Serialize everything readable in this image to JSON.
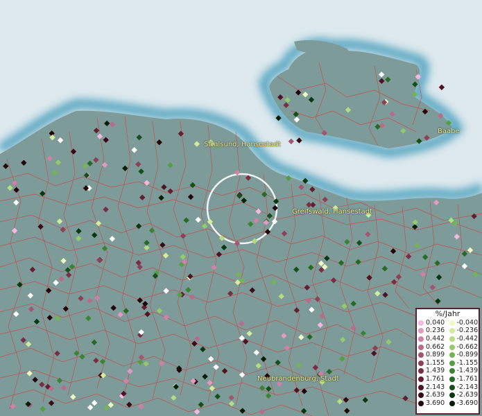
{
  "map": {
    "labels": [
      {
        "text": "Stralsund, Hansestadt"
      },
      {
        "text": "Greifswald, Hansestadt"
      },
      {
        "text": "Neubrandenburg, Stadt"
      },
      {
        "text": "Baabe"
      }
    ]
  },
  "legend": {
    "title": "%/Jahr",
    "positive": [
      {
        "value": "0.040",
        "color": "#f6b8df"
      },
      {
        "value": "0.236",
        "color": "#e39ac1"
      },
      {
        "value": "0.442",
        "color": "#d081a5"
      },
      {
        "value": "0.662",
        "color": "#b86c8a"
      },
      {
        "value": "0.899",
        "color": "#a35671"
      },
      {
        "value": "1.155",
        "color": "#8e4058"
      },
      {
        "value": "1.439",
        "color": "#792e44"
      },
      {
        "value": "1.761",
        "color": "#641e32"
      },
      {
        "value": "2.143",
        "color": "#4e1222"
      },
      {
        "value": "2.639",
        "color": "#380915"
      },
      {
        "value": "3.690",
        "color": "#22030a"
      }
    ],
    "negative": [
      {
        "value": "-0.040",
        "color": "#eefac4"
      },
      {
        "value": "-0.236",
        "color": "#d2ec9c"
      },
      {
        "value": "-0.442",
        "color": "#b4dc82"
      },
      {
        "value": "-0.662",
        "color": "#94c96c"
      },
      {
        "value": "-0.899",
        "color": "#74b456"
      },
      {
        "value": "-1.155",
        "color": "#569d44"
      },
      {
        "value": "-1.439",
        "color": "#3c8434"
      },
      {
        "value": "-1.761",
        "color": "#266a26"
      },
      {
        "value": "-2.143",
        "color": "#15501a"
      },
      {
        "value": "-2.639",
        "color": "#083810"
      },
      {
        "value": "-3.690",
        "color": "#021e07"
      }
    ]
  },
  "colors": {
    "sea": "#dde9ee",
    "coast_glow": "#3f9ab8",
    "land": "#7d9b98",
    "boundaries": "#d43a3a",
    "highlight_circle": "#ffffff"
  }
}
